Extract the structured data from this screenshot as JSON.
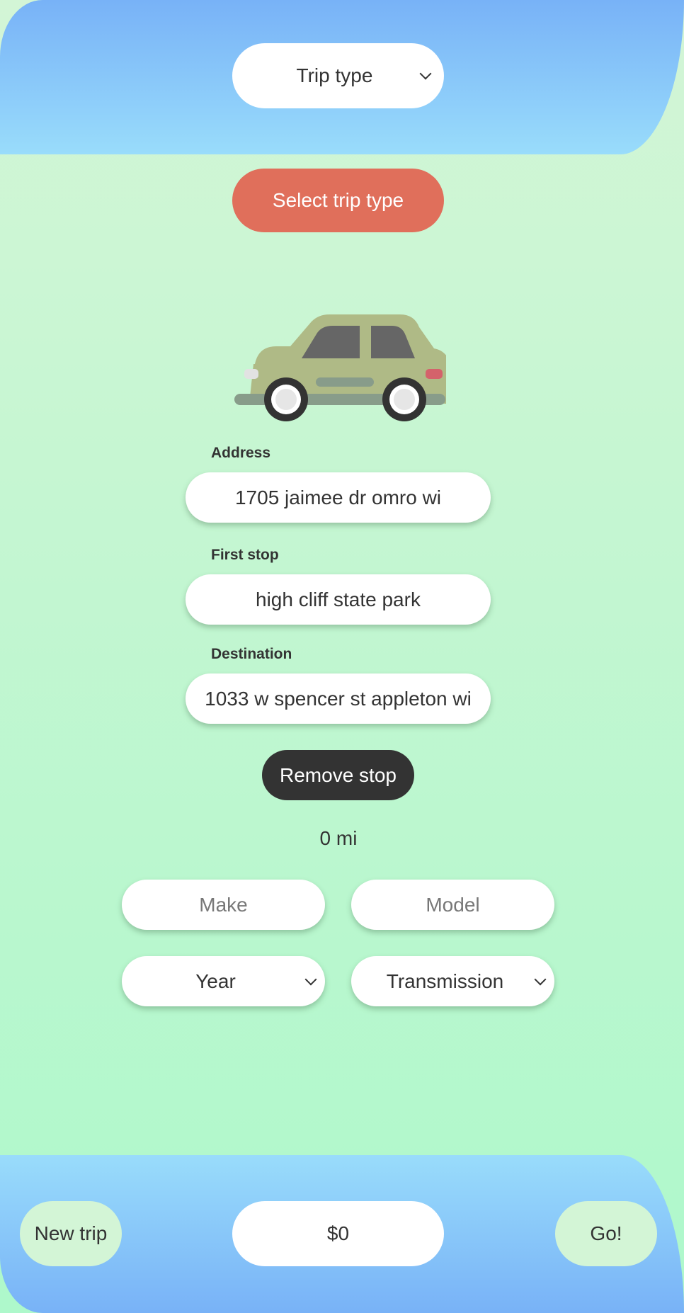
{
  "header": {
    "trip_type_select": {
      "selected": "Trip type"
    }
  },
  "main": {
    "select_trip_type_button": "Select trip type",
    "car_icon": "car-icon",
    "fields": [
      {
        "label": "Address",
        "value": "1705 jaimee dr omro wi"
      },
      {
        "label": "First stop",
        "value": "high cliff state park"
      },
      {
        "label": "Destination",
        "value": "1033 w spencer st appleton wi"
      }
    ],
    "remove_stop_button": "Remove stop",
    "distance": "0 mi",
    "vehicle": {
      "make_placeholder": "Make",
      "model_placeholder": "Model",
      "year_selected": "Year",
      "transmission_selected": "Transmission"
    }
  },
  "footer": {
    "new_trip_button": "New trip",
    "cost": "$0",
    "go_button": "Go!"
  },
  "colors": {
    "accent_red": "#e06f5b",
    "dark_button": "#333333",
    "light_green": "#d3f5d6",
    "blue": "#78b2f7"
  }
}
